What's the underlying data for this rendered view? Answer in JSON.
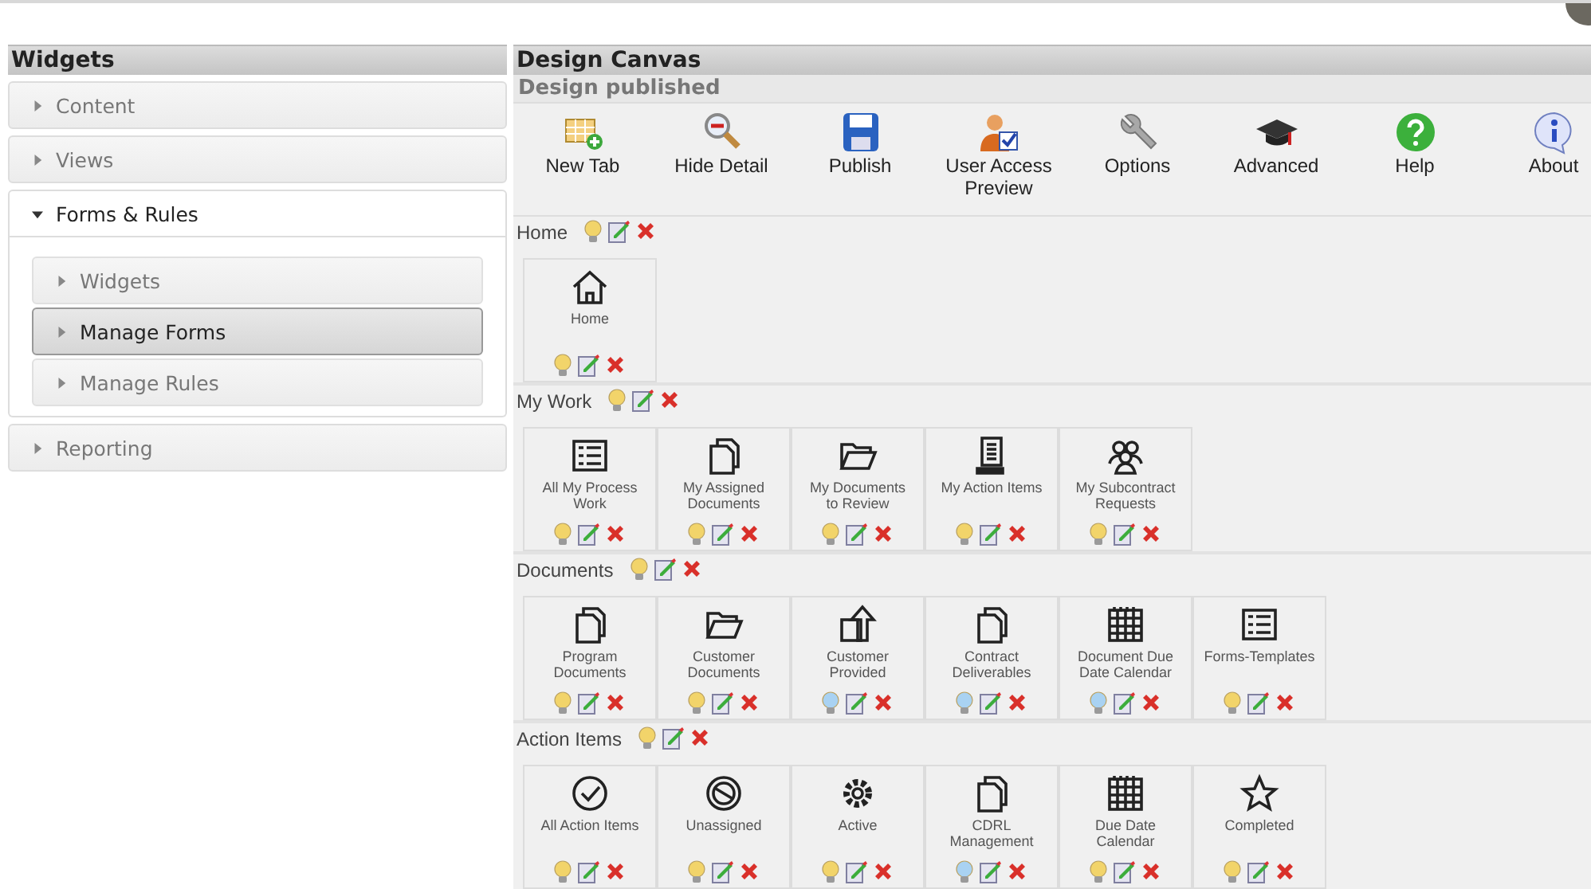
{
  "sidebar": {
    "title": "Widgets",
    "items": [
      {
        "label": "Content",
        "expanded": false
      },
      {
        "label": "Views",
        "expanded": false
      },
      {
        "label": "Forms & Rules",
        "expanded": true,
        "children": [
          {
            "label": "Widgets",
            "selected": false
          },
          {
            "label": "Manage Forms",
            "selected": true
          },
          {
            "label": "Manage Rules",
            "selected": false
          }
        ]
      },
      {
        "label": "Reporting",
        "expanded": false
      }
    ]
  },
  "canvas": {
    "title": "Design Canvas",
    "status": "Design published",
    "toolbar": [
      {
        "label": "New Tab",
        "kind": "newtab"
      },
      {
        "label": "Hide Detail",
        "kind": "zoom"
      },
      {
        "label": "Publish",
        "kind": "save"
      },
      {
        "label": "User Access Preview",
        "kind": "user"
      },
      {
        "label": "Options",
        "kind": "wrench"
      },
      {
        "label": "Advanced",
        "kind": "cap"
      },
      {
        "label": "Help",
        "kind": "help"
      },
      {
        "label": "About",
        "kind": "info"
      }
    ],
    "sections": [
      {
        "label": "Home",
        "color": "#f2d46a",
        "tiles": [
          {
            "label": "Home",
            "kind": "home",
            "color": "#f2d46a"
          }
        ]
      },
      {
        "label": "My Work",
        "color": "#f2d46a",
        "tiles": [
          {
            "label": "All My Process Work",
            "kind": "list",
            "color": "#f2d46a"
          },
          {
            "label": "My Assigned Documents",
            "kind": "docs",
            "color": "#f2d46a"
          },
          {
            "label": "My Documents to Review",
            "kind": "folder",
            "color": "#f2d46a"
          },
          {
            "label": "My Action Items",
            "kind": "clipboard",
            "color": "#f2d46a"
          },
          {
            "label": "My Subcontract Requests",
            "kind": "people",
            "color": "#f2d46a"
          }
        ]
      },
      {
        "label": "Documents",
        "color": "#f2d46a",
        "tiles": [
          {
            "label": "Program Documents",
            "kind": "docs",
            "color": "#f2d46a"
          },
          {
            "label": "Customer Documents",
            "kind": "folder",
            "color": "#f2d46a"
          },
          {
            "label": "Customer Provided",
            "kind": "upload",
            "color": "#a9d2f2"
          },
          {
            "label": "Contract Deliverables",
            "kind": "docs",
            "color": "#a9d2f2"
          },
          {
            "label": "Document Due Date Calendar",
            "kind": "calendar",
            "color": "#a9d2f2"
          },
          {
            "label": "Forms-Templates",
            "kind": "list",
            "color": "#f2d46a"
          }
        ]
      },
      {
        "label": "Action Items",
        "color": "#f2d46a",
        "tiles": [
          {
            "label": "All Action Items",
            "kind": "check",
            "color": "#f2d46a"
          },
          {
            "label": "Unassigned",
            "kind": "nosign",
            "color": "#f2d46a"
          },
          {
            "label": "Active",
            "kind": "gear",
            "color": "#f2d46a"
          },
          {
            "label": "CDRL Management",
            "kind": "docs",
            "color": "#a9d2f2"
          },
          {
            "label": "Due Date Calendar",
            "kind": "calendar",
            "color": "#f2d46a"
          },
          {
            "label": "Completed",
            "kind": "star",
            "color": "#f2d46a"
          }
        ]
      }
    ]
  }
}
